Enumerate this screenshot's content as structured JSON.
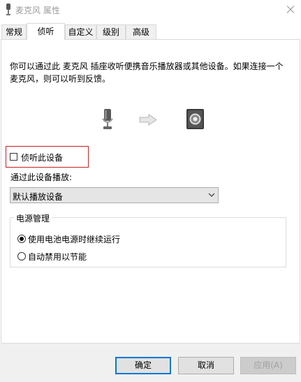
{
  "window": {
    "title": "麦克风 属性"
  },
  "tabs": [
    {
      "label": "常规",
      "active": false
    },
    {
      "label": "侦听",
      "active": true
    },
    {
      "label": "自定义",
      "active": false
    },
    {
      "label": "级别",
      "active": false
    },
    {
      "label": "高级",
      "active": false
    }
  ],
  "listen": {
    "description": "你可以通过此 麦克风 插座收听便携音乐播放器或其他设备。如果连接一个麦克风，则可以听到反馈。",
    "listen_checkbox_label": "侦听此设备",
    "listen_checked": false,
    "playback_label": "通过此设备播放:",
    "playback_device": "默认播放设备"
  },
  "power": {
    "group_title": "电源管理",
    "options": [
      {
        "label": "使用电池电源时继续运行",
        "selected": true
      },
      {
        "label": "自动禁用以节能",
        "selected": false
      }
    ]
  },
  "buttons": {
    "ok": "确定",
    "cancel": "取消",
    "apply": "应用(A)"
  },
  "colors": {
    "highlight_border": "#c62020",
    "default_button_border": "#0078d7"
  }
}
